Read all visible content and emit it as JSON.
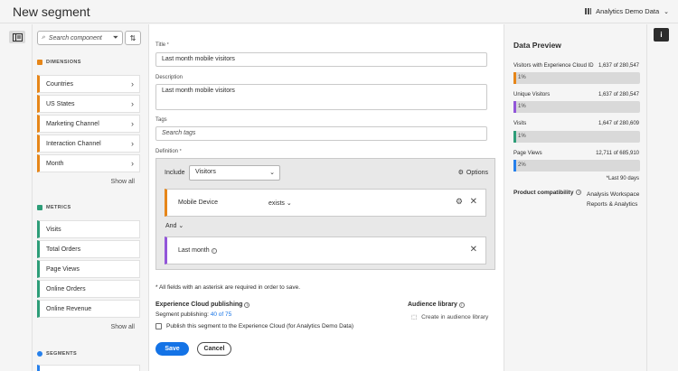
{
  "header": {
    "title": "New segment",
    "report_suite": "Analytics Demo Data"
  },
  "components": {
    "search_placeholder": "Search component",
    "dimensions": {
      "heading": "DIMENSIONS",
      "items": [
        "Countries",
        "US States",
        "Marketing Channel",
        "Interaction Channel",
        "Month"
      ],
      "show_all": "Show all"
    },
    "metrics": {
      "heading": "METRICS",
      "items": [
        "Visits",
        "Total Orders",
        "Page Views",
        "Online Orders",
        "Online Revenue"
      ],
      "show_all": "Show all"
    },
    "segments": {
      "heading": "SEGMENTS"
    }
  },
  "form": {
    "title_label": "Title",
    "title_value": "Last month mobile visitors",
    "description_label": "Description",
    "description_value": "Last month mobile visitors",
    "tags_label": "Tags",
    "tags_placeholder": "Search tags",
    "definition_label": "Definition",
    "required_mark": "*",
    "include_label": "Include",
    "include_value": "Visitors",
    "options_label": "Options",
    "rules": [
      {
        "name": "Mobile Device",
        "operator": "exists",
        "color": "#e68619"
      },
      {
        "name": "Last month",
        "operator": "",
        "color": "#9256d9"
      }
    ],
    "and_label": "And",
    "required_note": "* All fields with an asterisk are required in order to save.",
    "publishing_heading": "Experience Cloud publishing",
    "publishing_count_label": "Segment publishing:",
    "publishing_count": "40 of 75",
    "publish_checkbox": "Publish this segment to the Experience Cloud (for Analytics Demo Data)",
    "audience_heading": "Audience library",
    "audience_link": "Create in audience library",
    "save_label": "Save",
    "cancel_label": "Cancel"
  },
  "preview": {
    "title": "Data Preview",
    "stats": [
      {
        "label": "Visitors with Experience Cloud ID",
        "value": "1,637 of 280,547",
        "pct": "1%",
        "fraction": 0.01,
        "color": "#e68619"
      },
      {
        "label": "Unique Visitors",
        "value": "1,637 of 280,547",
        "pct": "1%",
        "fraction": 0.01,
        "color": "#9256d9"
      },
      {
        "label": "Visits",
        "value": "1,647 of 280,609",
        "pct": "1%",
        "fraction": 0.01,
        "color": "#2d9d78"
      },
      {
        "label": "Page Views",
        "value": "12,711 of 685,910",
        "pct": "2%",
        "fraction": 0.02,
        "color": "#2680eb"
      }
    ],
    "footnote": "*Last 90 days",
    "compat_label": "Product compatibility",
    "compat_values": [
      "Analysis Workspace",
      "Reports & Analytics"
    ]
  }
}
